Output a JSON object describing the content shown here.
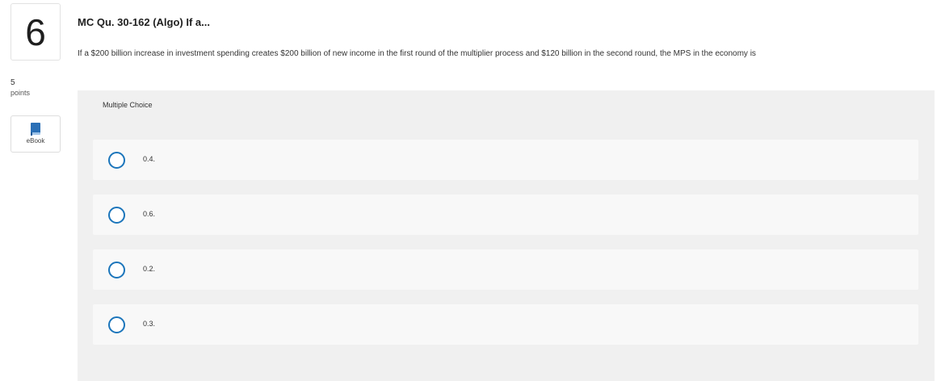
{
  "question": {
    "number": "6",
    "points_value": "5",
    "points_label": "points",
    "title": "MC Qu. 30-162 (Algo) If a...",
    "text": "If a $200 billion increase in investment spending creates $200 billion of new income in the first round of the multiplier process and $120 billion in the second round, the MPS in the economy is"
  },
  "ebook": {
    "label": "eBook",
    "icon": "book-icon"
  },
  "answer_panel": {
    "type_label": "Multiple Choice",
    "choices": [
      {
        "label": "0.4.",
        "selected": false
      },
      {
        "label": "0.6.",
        "selected": false
      },
      {
        "label": "0.2.",
        "selected": false
      },
      {
        "label": "0.3.",
        "selected": false
      }
    ]
  },
  "colors": {
    "radio_border": "#1b75bb",
    "book_icon": "#2a6fb6",
    "panel_bg": "#f0f0f0"
  }
}
